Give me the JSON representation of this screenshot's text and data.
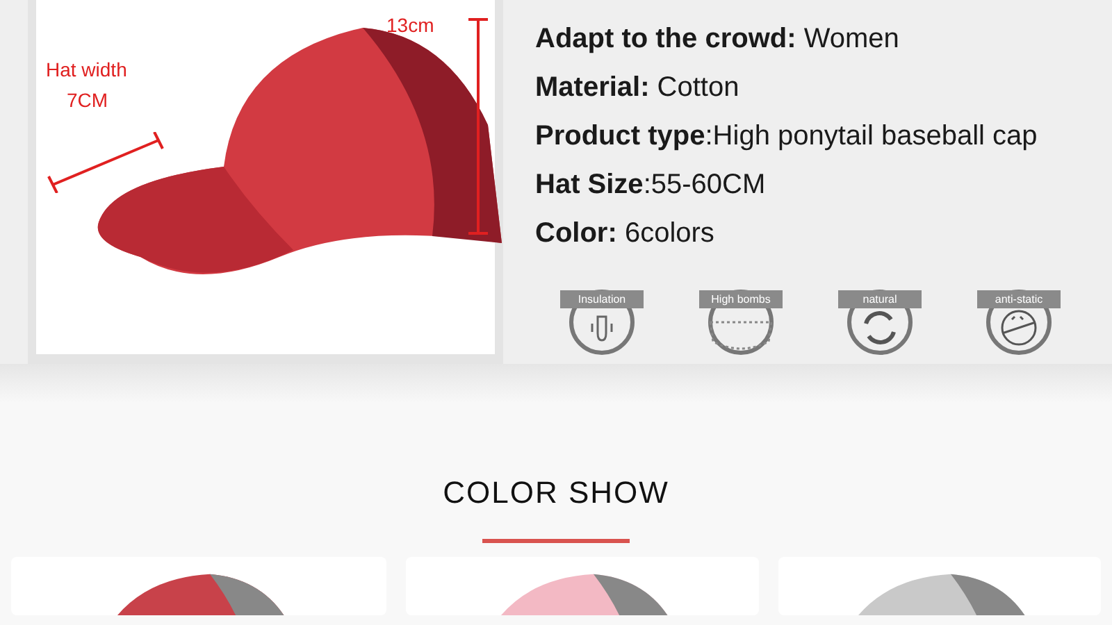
{
  "product_photo": {
    "width_label": "Hat width",
    "width_value": "7CM",
    "height_value": "13cm"
  },
  "specs": [
    {
      "text": "**Adapt to the crowd:** Women"
    },
    {
      "text": "**Material:** Cotton"
    },
    {
      "text": "**Product type**:High ponytail baseball cap"
    },
    {
      "text": "**Hat Size**:55-60CM"
    },
    {
      "text": "**Color:** 6colors"
    }
  ],
  "features": [
    {
      "label": "Insulation",
      "kind": "insulation"
    },
    {
      "label": "High bombs",
      "kind": "mesh"
    },
    {
      "label": "natural",
      "kind": "cycle"
    },
    {
      "label": "anti-static",
      "kind": "antistatic"
    }
  ],
  "section": {
    "title": "COLOR SHOW"
  },
  "color_cards": [
    {
      "color": "#c8424a"
    },
    {
      "color": "#f3b9c4"
    },
    {
      "color": "#c9c9c9"
    }
  ]
}
